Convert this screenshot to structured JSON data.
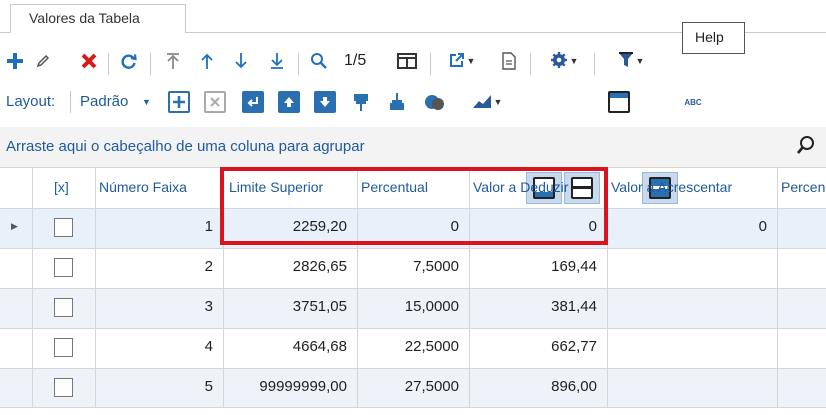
{
  "tab": {
    "label": "Valores da Tabela"
  },
  "tooltip": {
    "help": "Help"
  },
  "toolbar": {
    "record_counter": "1/5"
  },
  "layout_bar": {
    "label": "Layout:",
    "value": "Padrão"
  },
  "group_bar": {
    "text": "Arraste aqui o cabeçalho de uma coluna para agrupar"
  },
  "grid": {
    "columns": [
      "[x]",
      "Número Faixa",
      "Limite Superior",
      "Percentual",
      "Valor a Deduzir",
      "Valor a Acrescentar",
      "Percen"
    ],
    "rows": [
      {
        "faixa": "1",
        "limite": "2259,20",
        "percentual": "0",
        "deduzir": "0",
        "acrescentar": "0"
      },
      {
        "faixa": "2",
        "limite": "2826,65",
        "percentual": "7,5000",
        "deduzir": "169,44",
        "acrescentar": ""
      },
      {
        "faixa": "3",
        "limite": "3751,05",
        "percentual": "15,0000",
        "deduzir": "381,44",
        "acrescentar": ""
      },
      {
        "faixa": "4",
        "limite": "4664,68",
        "percentual": "22,5000",
        "deduzir": "662,77",
        "acrescentar": ""
      },
      {
        "faixa": "5",
        "limite": "99999999,00",
        "percentual": "27,5000",
        "deduzir": "896,00",
        "acrescentar": ""
      }
    ]
  },
  "colors": {
    "accent": "#1e5a9c",
    "highlight": "#d9141e",
    "selected_row": "#e8f0fa",
    "alt_row": "#eef3fa"
  },
  "icons": [
    "add-icon",
    "edit-icon",
    "delete-icon",
    "refresh-icon",
    "first-icon",
    "prev-icon",
    "next-icon",
    "last-icon",
    "search-icon",
    "columns-icon",
    "export-icon",
    "report-icon",
    "settings-icon",
    "filter-icon"
  ]
}
